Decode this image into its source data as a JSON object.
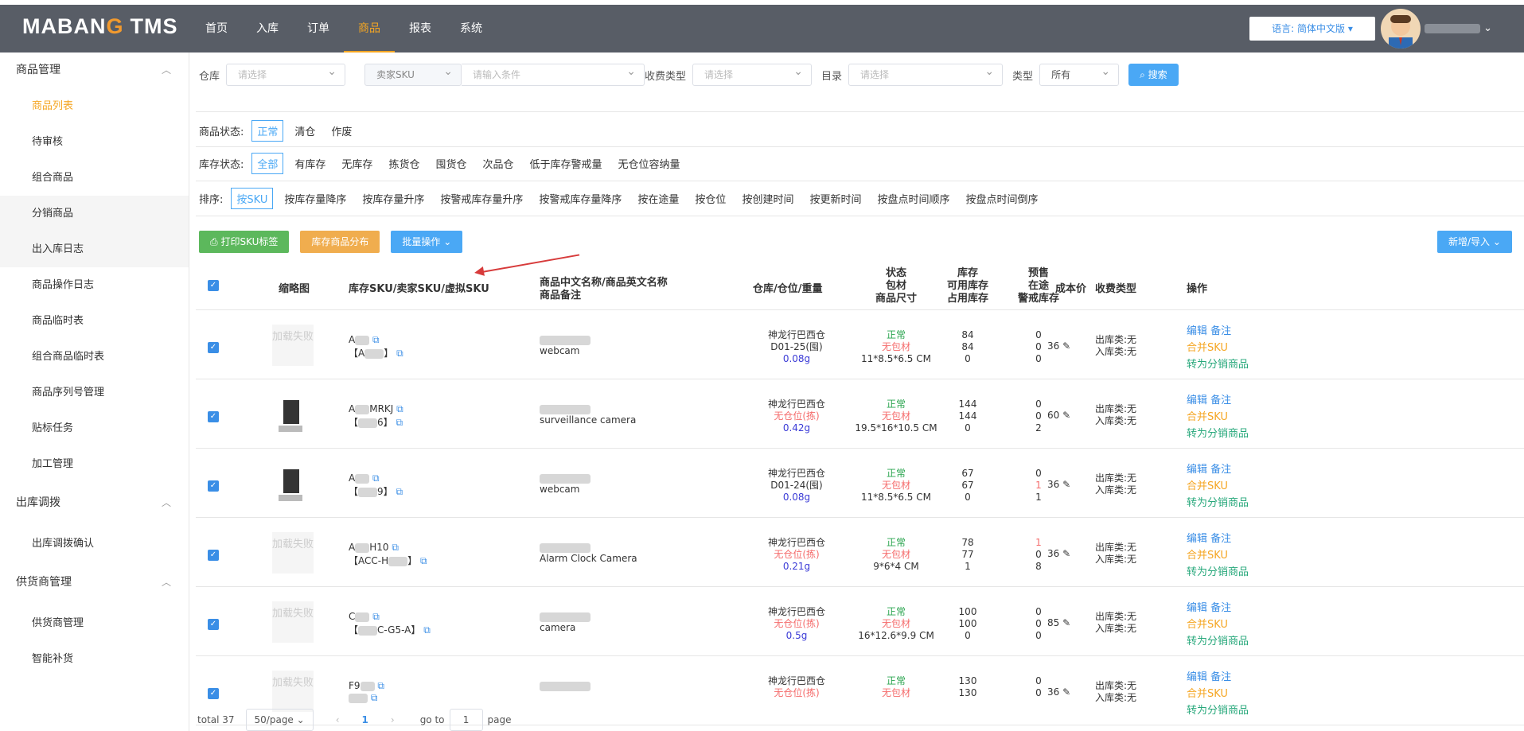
{
  "brand": {
    "logo_a": "MABAN",
    "logo_b": "G",
    "logo_c": "TMS"
  },
  "nav": [
    "首页",
    "入库",
    "订单",
    "商品",
    "报表",
    "系统"
  ],
  "nav_active": "商品",
  "lang_label": "语言: 简体中文版",
  "user_name": "",
  "sidebar": {
    "g1": "商品管理",
    "g1_items": [
      "商品列表",
      "待审核",
      "组合商品",
      "分销商品",
      "出入库日志",
      "商品操作日志",
      "商品临时表",
      "组合商品临时表",
      "商品序列号管理",
      "贴标任务",
      "加工管理"
    ],
    "g2": "出库调拨",
    "g2_items": [
      "出库调拨确认"
    ],
    "g3": "供货商管理",
    "g3_items": [
      "供货商管理",
      "智能补货"
    ]
  },
  "filters": {
    "warehouse_label": "仓库",
    "warehouse_ph": "请选择",
    "sku_type": "卖家SKU",
    "cond_ph": "请输入条件",
    "fee_label": "收费类型",
    "fee_ph": "请选择",
    "cat_label": "目录",
    "cat_ph": "请选择",
    "type_label": "类型",
    "type_val": "所有",
    "search": "搜索"
  },
  "status": {
    "label": "商品状态:",
    "opts": [
      "正常",
      "清仓",
      "作废"
    ]
  },
  "stock": {
    "label": "库存状态:",
    "opts": [
      "全部",
      "有库存",
      "无库存",
      "拣货仓",
      "囤货仓",
      "次品仓",
      "低于库存警戒量",
      "无仓位容纳量"
    ]
  },
  "sort": {
    "label": "排序:",
    "opts": [
      "按SKU",
      "按库存量降序",
      "按库存量升序",
      "按警戒库存量升序",
      "按警戒库存量降序",
      "按在途量",
      "按仓位",
      "按创建时间",
      "按更新时间",
      "按盘点时间顺序",
      "按盘点时间倒序"
    ]
  },
  "actions": {
    "print": "打印SKU标签",
    "dist": "库存商品分布",
    "batch": "批量操作",
    "new": "新增/导入"
  },
  "headers": {
    "thumb": "缩略图",
    "sku": "库存SKU/卖家SKU/虚拟SKU",
    "name1": "商品中文名称/商品英文名称",
    "name2": "商品备注",
    "wh": "仓库/仓位/重量",
    "st1": "状态",
    "st2": "包材",
    "st3": "商品尺寸",
    "inv1": "库存",
    "inv2": "可用库存",
    "inv3": "占用库存",
    "pre1": "预售",
    "pre2": "在途",
    "pre3": "警戒库存",
    "cost": "成本价",
    "fee": "收费类型",
    "op": "操作"
  },
  "rows": [
    {
      "thumb": "加载失败",
      "sku1": "A",
      "sku2": "【A",
      "sku2b": "】",
      "name": "webcam",
      "wh": "神龙行巴西仓",
      "pos": "D01-25(囤)",
      "weight": "0.08g",
      "st": "正常",
      "pack": "无包材",
      "size": "11*8.5*6.5 CM",
      "inv": [
        "84",
        "84",
        "0"
      ],
      "pre": [
        "0",
        "0",
        "0"
      ],
      "cost": "36",
      "fee1": "出库类:无",
      "fee2": "入库类:无"
    },
    {
      "thumb": "",
      "sku1": "A",
      "sku1b": "MRKJ",
      "sku2": "【",
      "sku2b": "6】",
      "name": "surveillance camera",
      "wh": "神龙行巴西仓",
      "pos": "无仓位(拣)",
      "weight": "0.42g",
      "st": "正常",
      "pack": "无包材",
      "size": "19.5*16*10.5 CM",
      "inv": [
        "144",
        "144",
        "0"
      ],
      "pre": [
        "0",
        "0",
        "2"
      ],
      "cost": "60",
      "fee1": "出库类:无",
      "fee2": "入库类:无"
    },
    {
      "thumb": "",
      "sku1": "A",
      "sku2": "【",
      "sku2b": "9】",
      "name": "webcam",
      "wh": "神龙行巴西仓",
      "pos": "D01-24(囤)",
      "weight": "0.08g",
      "st": "正常",
      "pack": "无包材",
      "size": "11*8.5*6.5 CM",
      "inv": [
        "67",
        "67",
        "0"
      ],
      "pre": [
        "0",
        "1",
        "1"
      ],
      "cost": "36",
      "fee1": "出库类:无",
      "fee2": "入库类:无"
    },
    {
      "thumb": "加载失败",
      "sku1": "A",
      "sku1b": "H10",
      "sku2": "【ACC-H",
      "sku2b": "】",
      "name": "Alarm Clock Camera",
      "wh": "神龙行巴西仓",
      "pos": "无仓位(拣)",
      "weight": "0.21g",
      "st": "正常",
      "pack": "无包材",
      "size": "9*6*4 CM",
      "inv": [
        "78",
        "77",
        "1"
      ],
      "pre": [
        "1",
        "0",
        "8"
      ],
      "cost": "36",
      "fee1": "出库类:无",
      "fee2": "入库类:无"
    },
    {
      "thumb": "加载失败",
      "sku1": "C",
      "sku2": "【",
      "sku2b": "C-G5-A】",
      "name": "camera",
      "wh": "神龙行巴西仓",
      "pos": "无仓位(拣)",
      "weight": "0.5g",
      "st": "正常",
      "pack": "无包材",
      "size": "16*12.6*9.9 CM",
      "inv": [
        "100",
        "100",
        "0"
      ],
      "pre": [
        "0",
        "0",
        "0"
      ],
      "cost": "85",
      "fee1": "出库类:无",
      "fee2": "入库类:无"
    },
    {
      "thumb": "加载失败",
      "sku1": "F9",
      "sku2": "",
      "sku2b": "",
      "name": "",
      "wh": "神龙行巴西仓",
      "pos": "无仓位(拣)",
      "weight": "",
      "st": "正常",
      "pack": "无包材",
      "size": "",
      "inv": [
        "130",
        "130",
        ""
      ],
      "pre": [
        "0",
        "0",
        ""
      ],
      "cost": "36",
      "fee1": "出库类:无",
      "fee2": "入库类:无"
    }
  ],
  "op_links": {
    "edit": "编辑",
    "note": "备注",
    "merge": "合并SKU",
    "convert": "转为分销商品"
  },
  "pager": {
    "total": "total 37",
    "size": "50/page",
    "current": "1",
    "goto": "go to",
    "goto_val": "1",
    "page": "page"
  }
}
